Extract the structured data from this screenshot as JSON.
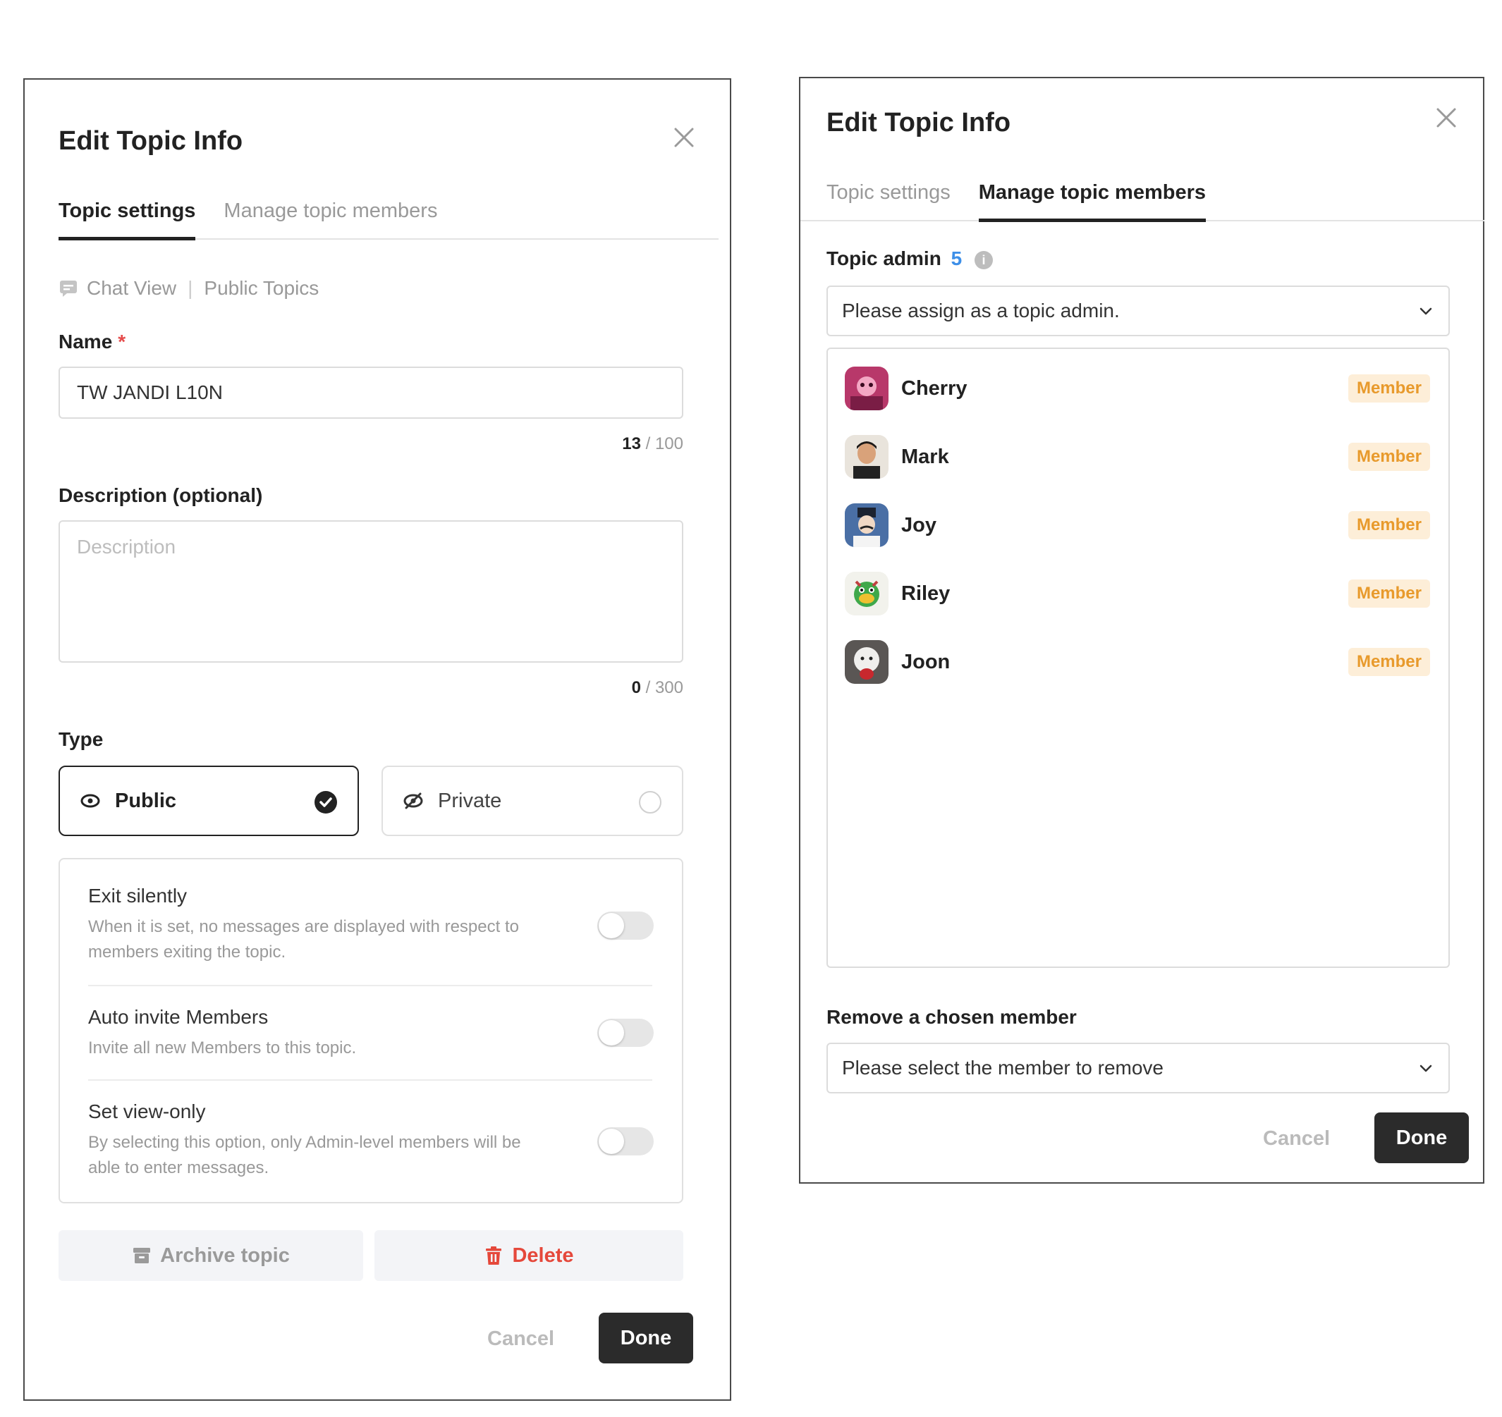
{
  "left": {
    "title": "Edit Topic Info",
    "tabs": [
      "Topic settings",
      "Manage topic members"
    ],
    "breadcrumb": [
      "Chat View",
      "Public Topics"
    ],
    "name_label": "Name",
    "name_required": "*",
    "name_value": "TW JANDI L10N",
    "name_count": "13",
    "name_max": "/ 100",
    "desc_label": "Description (optional)",
    "desc_placeholder": "Description",
    "desc_count": "0",
    "desc_max": "/ 300",
    "type_label": "Type",
    "type_public": "Public",
    "type_private": "Private",
    "options": [
      {
        "title": "Exit silently",
        "desc": "When it is set, no messages are displayed with respect to members exiting the topic."
      },
      {
        "title": "Auto invite Members",
        "desc": "Invite all new Members to this topic."
      },
      {
        "title": "Set view-only",
        "desc": "By selecting this option, only Admin-level members will be able to enter messages."
      }
    ],
    "archive_label": "Archive topic",
    "delete_label": "Delete",
    "cancel_label": "Cancel",
    "done_label": "Done"
  },
  "right": {
    "title": "Edit Topic Info",
    "tabs": [
      "Topic settings",
      "Manage topic members"
    ],
    "admin_label": "Topic admin",
    "admin_count": "5",
    "admin_placeholder": "Please assign as a topic admin.",
    "members": [
      {
        "name": "Cherry",
        "role": "Member"
      },
      {
        "name": "Mark",
        "role": "Member"
      },
      {
        "name": "Joy",
        "role": "Member"
      },
      {
        "name": "Riley",
        "role": "Member"
      },
      {
        "name": "Joon",
        "role": "Member"
      }
    ],
    "remove_label": "Remove a chosen member",
    "remove_placeholder": "Please select the member to remove",
    "cancel_label": "Cancel",
    "done_label": "Done"
  },
  "colors": {
    "accent_dark": "#2b2b2b",
    "delete_red": "#e5483b",
    "badge_bg": "#fdeed8",
    "badge_text": "#e89a2c",
    "admin_count_blue": "#3d8fe8"
  }
}
